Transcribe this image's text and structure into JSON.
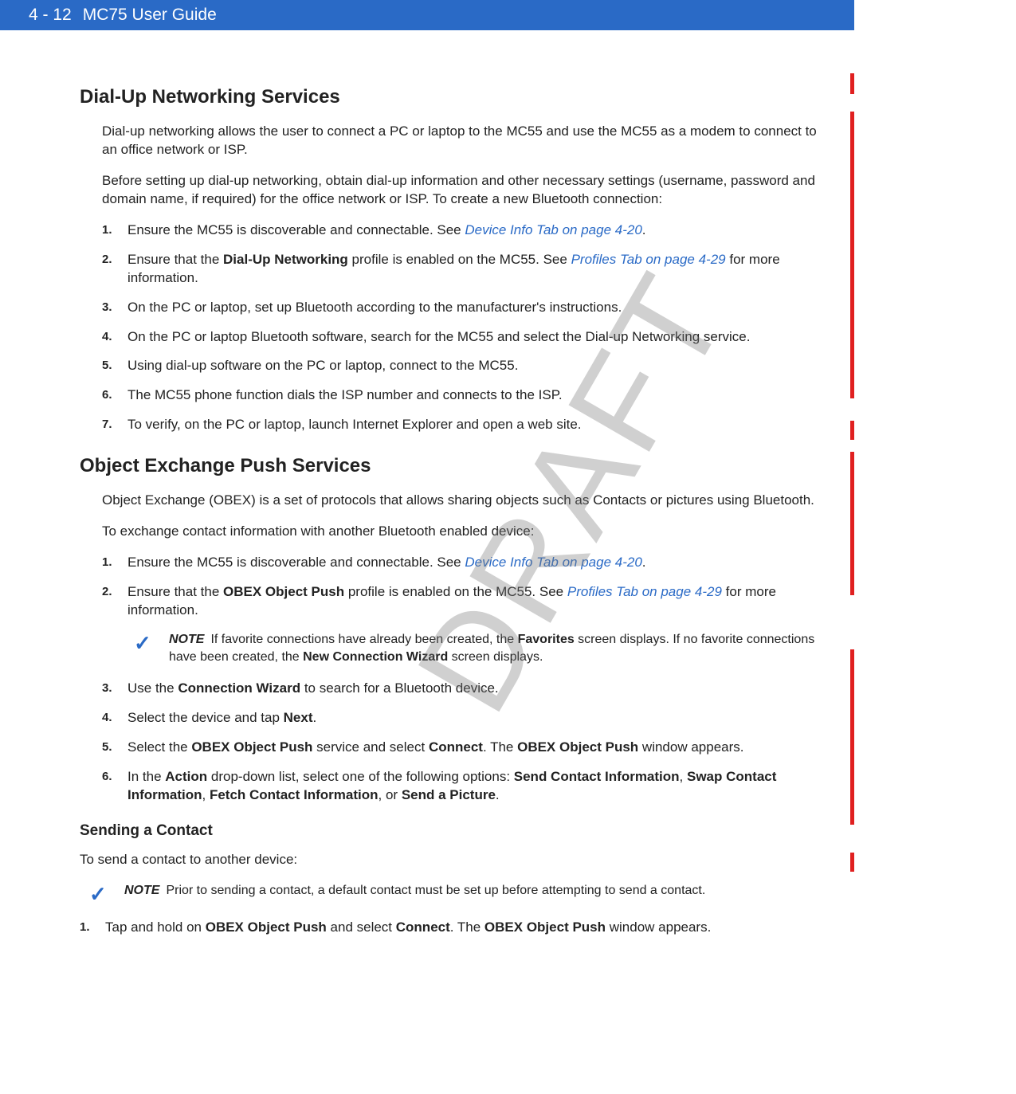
{
  "header": {
    "page_num": "4 - 12",
    "title": "MC75 User Guide"
  },
  "watermark": "DRAFT",
  "s1": {
    "title": "Dial-Up Networking Services",
    "p1": "Dial-up networking allows the user to connect a PC or laptop to the MC55 and use the MC55 as a modem to connect to an office network or ISP.",
    "p2": "Before setting up dial-up networking, obtain dial-up information and other necessary settings (username, password and domain name, if required) for the office network or ISP. To create a new Bluetooth connection:",
    "items": {
      "n1": "1.",
      "t1a": "Ensure the MC55 is discoverable and connectable. See ",
      "t1link": "Device Info Tab on page 4-20",
      "t1b": ".",
      "n2": "2.",
      "t2a": "Ensure that the ",
      "t2bold": "Dial-Up Networking",
      "t2b": " profile is enabled on the MC55. See ",
      "t2link": "Profiles Tab on page 4-29",
      "t2c": " for more information.",
      "n3": "3.",
      "t3": "On the PC or laptop, set up Bluetooth according to the manufacturer's instructions.",
      "n4": "4.",
      "t4": "On the PC or laptop Bluetooth software, search for the MC55 and select the Dial-up Networking service.",
      "n5": "5.",
      "t5": "Using dial-up software on the PC or laptop, connect to the MC55.",
      "n6": "6.",
      "t6": "The MC55 phone function dials the ISP number and connects to the ISP.",
      "n7": "7.",
      "t7": "To verify, on the PC or laptop, launch Internet Explorer and open a web site."
    }
  },
  "s2": {
    "title": "Object Exchange Push Services",
    "p1": "Object Exchange (OBEX) is a set of protocols that allows sharing objects such as Contacts or pictures using Bluetooth.",
    "p2": "To exchange contact information with another Bluetooth enabled device:",
    "items": {
      "n1": "1.",
      "t1a": "Ensure the MC55 is discoverable and connectable. See ",
      "t1link": "Device Info Tab on page 4-20",
      "t1b": ".",
      "n2": "2.",
      "t2a": "Ensure that the ",
      "t2bold": "OBEX Object Push",
      "t2b": " profile is enabled on the MC55. See ",
      "t2link": "Profiles Tab on page 4-29",
      "t2c": " for more information.",
      "noteLabel": "NOTE",
      "noteTextA": "If favorite connections have already been created, the ",
      "noteBold1": "Favorites",
      "noteTextB": " screen displays. If no favorite connections have been created, the ",
      "noteBold2": "New Connection Wizard",
      "noteTextC": " screen displays.",
      "n3": "3.",
      "t3a": "Use the ",
      "t3bold": "Connection Wizard",
      "t3b": " to search for a Bluetooth device.",
      "n4": "4.",
      "t4a": "Select the device and tap ",
      "t4bold": "Next",
      "t4b": ".",
      "n5": "5.",
      "t5a": "Select the ",
      "t5b1": "OBEX Object Push",
      "t5b": " service and select ",
      "t5b2": "Connect",
      "t5c": ". The ",
      "t5b3": "OBEX Object Push",
      "t5d": " window appears.",
      "n6": "6.",
      "t6a": "In the ",
      "t6b1": "Action",
      "t6b": " drop-down list, select one of the following options: ",
      "t6b2": "Send Contact Information",
      "t6c": ", ",
      "t6b3": "Swap Contact Information",
      "t6d": ", ",
      "t6b4": "Fetch Contact Information",
      "t6e": ", or ",
      "t6b5": "Send a Picture",
      "t6f": "."
    }
  },
  "s3": {
    "title": "Sending a Contact",
    "p1": "To send a contact to another device:",
    "noteLabel": "NOTE",
    "noteText": "Prior to sending a contact, a default contact must be set up before attempting to send a contact.",
    "n1": "1.",
    "t1a": "Tap and hold on ",
    "t1b1": "OBEX Object Push",
    "t1b": " and select ",
    "t1b2": "Connect",
    "t1c": ". The ",
    "t1b3": "OBEX Object Push",
    "t1d": " window appears."
  }
}
